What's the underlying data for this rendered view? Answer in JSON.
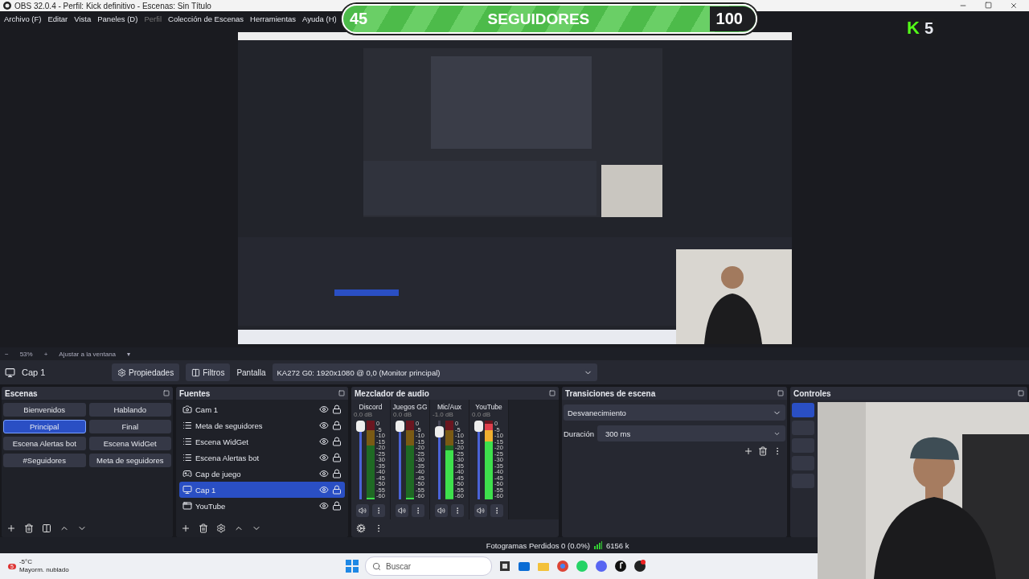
{
  "window": {
    "title": "OBS 32.0.4 - Perfil: Kick definitivo - Escenas: Sin Título"
  },
  "menu": [
    {
      "label": "Archivo (F)",
      "disabled": false
    },
    {
      "label": "Editar",
      "disabled": false
    },
    {
      "label": "Vista",
      "disabled": false
    },
    {
      "label": "Paneles (D)",
      "disabled": false
    },
    {
      "label": "Perfil",
      "disabled": true
    },
    {
      "label": "Colección de Escenas",
      "disabled": false
    },
    {
      "label": "Herramientas",
      "disabled": false
    },
    {
      "label": "Ayuda (H)",
      "disabled": false
    }
  ],
  "overlay": {
    "goal": {
      "current": "45",
      "label": "SEGUIDORES",
      "target": "100"
    },
    "badge": {
      "logo": "K",
      "count": "5"
    }
  },
  "zoom_bar": {
    "minus": "−",
    "percent": "53%",
    "plus": "+",
    "fit": "Ajustar a la ventana",
    "fit_caret": "▾"
  },
  "source_toolbar": {
    "source": "Cap 1",
    "properties": "Propiedades",
    "filters": "Filtros",
    "display_label": "Pantalla",
    "display_value": "KA272 G0: 1920x1080 @ 0,0 (Monitor principal)"
  },
  "scenes": {
    "title": "Escenas",
    "items": [
      {
        "label": "Bienvenidos",
        "selected": false
      },
      {
        "label": "Hablando",
        "selected": false
      },
      {
        "label": "Principal",
        "selected": true
      },
      {
        "label": "Final",
        "selected": false
      },
      {
        "label": "Escena Alertas bot",
        "selected": false
      },
      {
        "label": "Escena WidGet",
        "selected": false
      },
      {
        "label": "#Seguidores",
        "selected": false
      },
      {
        "label": "Meta de seguidores",
        "selected": false
      }
    ]
  },
  "sources": {
    "title": "Fuentes",
    "items": [
      {
        "name": "Cam 1",
        "kind": "camera",
        "selected": false,
        "visible": true,
        "locked": true
      },
      {
        "name": "Meta de seguidores",
        "kind": "scene",
        "selected": false,
        "visible": true,
        "locked": true
      },
      {
        "name": "Escena WidGet",
        "kind": "scene",
        "selected": false,
        "visible": true,
        "locked": true
      },
      {
        "name": "Escena Alertas bot",
        "kind": "scene",
        "selected": false,
        "visible": true,
        "locked": true
      },
      {
        "name": "Cap de juego",
        "kind": "game",
        "selected": false,
        "visible": true,
        "locked": true
      },
      {
        "name": "Cap 1",
        "kind": "display",
        "selected": true,
        "visible": true,
        "locked": true
      },
      {
        "name": "YouTube",
        "kind": "window",
        "selected": false,
        "visible": true,
        "locked": true
      }
    ]
  },
  "mixer": {
    "title": "Mezclador de audio",
    "channels": [
      {
        "name": "Discord",
        "reading": "0.0 dB",
        "muted": false,
        "fader": {
          "level": 1
        },
        "meter": {
          "level": 0.02
        },
        "scale": [
          "0",
          "-5",
          "-10",
          "-15",
          "-20",
          "-25",
          "-30",
          "-35",
          "-40",
          "-45",
          "-50",
          "-55",
          "-60"
        ]
      },
      {
        "name": "Juegos GG",
        "reading": "0.0 dB",
        "muted": false,
        "fader": {
          "level": 1
        },
        "meter": {
          "level": 0.02
        },
        "scale": [
          "0",
          "-5",
          "-10",
          "-15",
          "-20",
          "-25",
          "-30",
          "-35",
          "-40",
          "-45",
          "-50",
          "-55",
          "-60"
        ]
      },
      {
        "name": "Mic/Aux",
        "reading": "-1.0 dB",
        "muted": false,
        "fader": {
          "level": 0.93
        },
        "meter": {
          "level": 0.62
        },
        "scale": [
          "0",
          "-5",
          "-10",
          "-15",
          "-20",
          "-25",
          "-30",
          "-35",
          "-40",
          "-45",
          "-50",
          "-55",
          "-60"
        ]
      },
      {
        "name": "YouTube",
        "reading": "0.0 dB",
        "muted": false,
        "fader": {
          "level": 1
        },
        "meter": {
          "level": 0.96
        },
        "scale": [
          "0",
          "-5",
          "-10",
          "-15",
          "-20",
          "-25",
          "-30",
          "-35",
          "-40",
          "-45",
          "-50",
          "-55",
          "-60"
        ]
      }
    ]
  },
  "transitions": {
    "title": "Transiciones de escena",
    "type": "Desvanecimiento",
    "duration_label": "Duración",
    "duration": "300 ms"
  },
  "controls": {
    "title": "Controles",
    "buttons": [
      {
        "selected": true
      },
      {
        "selected": false
      },
      {
        "selected": false
      },
      {
        "selected": false
      },
      {
        "selected": false
      }
    ]
  },
  "status": {
    "dropped": "Fotogramas Perdidos 0 (0.0%)",
    "bitrate": "6156 k"
  },
  "taskbar": {
    "weather_badge": "5",
    "temperature": "-5°C",
    "condition": "Mayorm. nublado",
    "search_placeholder": "Buscar"
  }
}
